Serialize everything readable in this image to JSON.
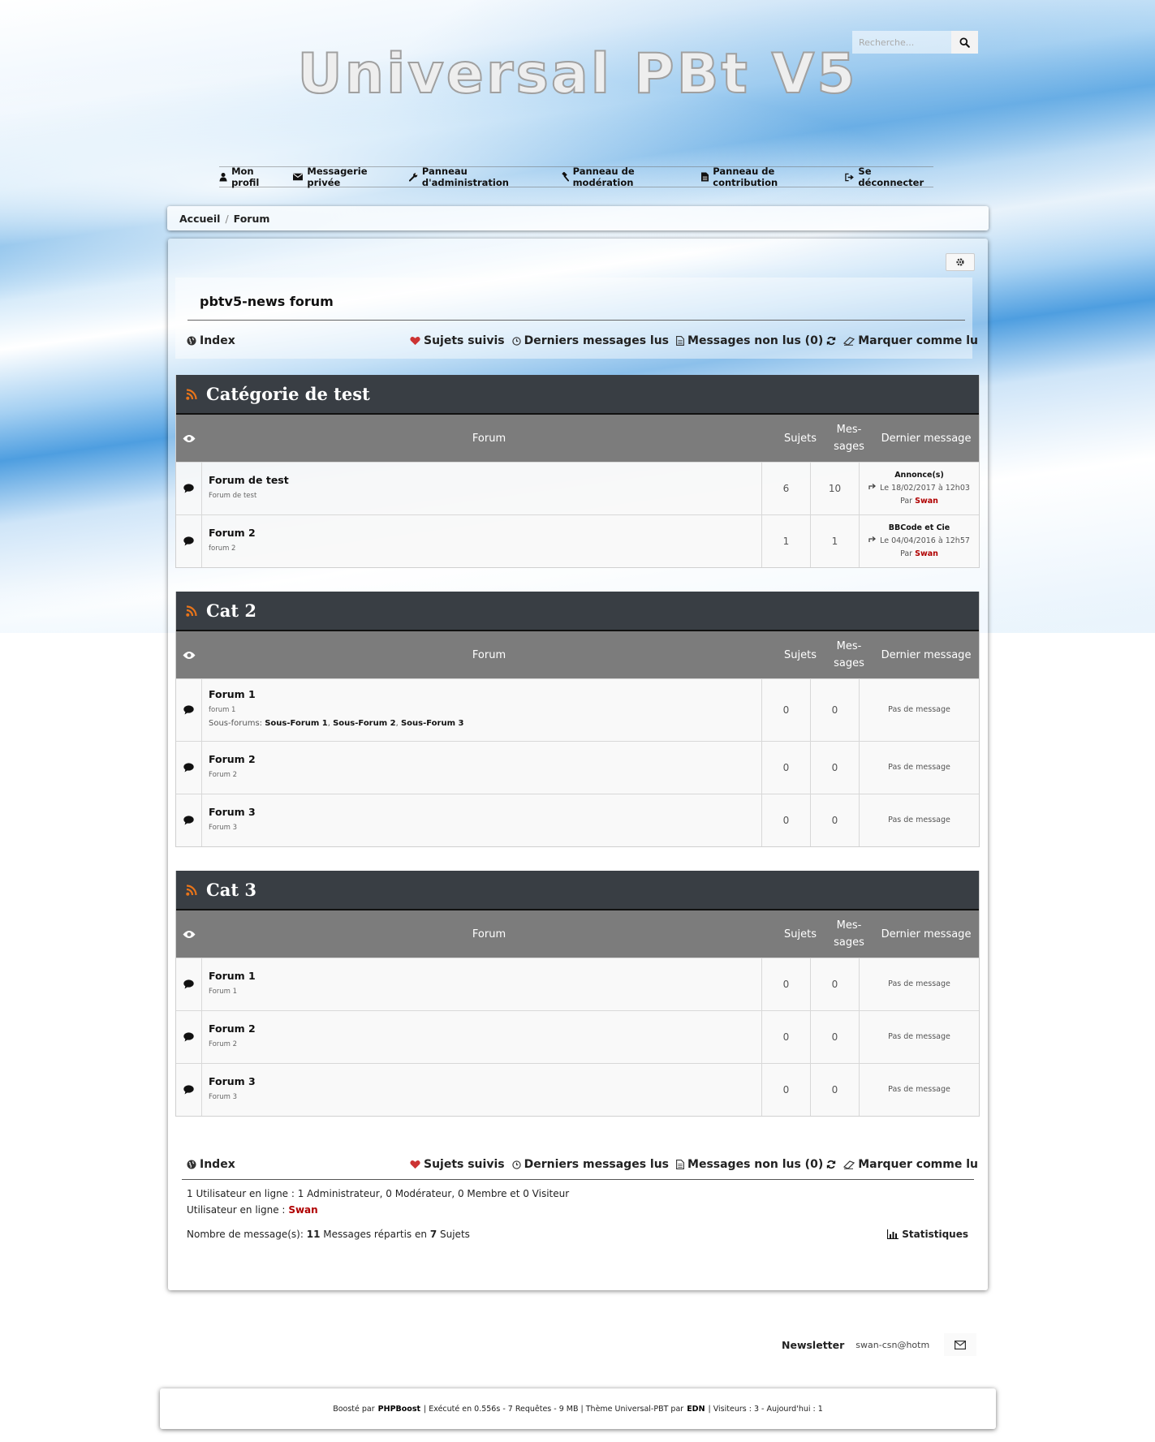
{
  "site": {
    "title": "Universal PBt V5"
  },
  "search": {
    "placeholder": "Recherche..."
  },
  "nav": [
    {
      "label": "Mon profil",
      "icon": "user-icon"
    },
    {
      "label": "Messagerie privée",
      "icon": "envelope-icon"
    },
    {
      "label": "Panneau d'administration",
      "icon": "wrench-icon"
    },
    {
      "label": "Panneau de modération",
      "icon": "gavel-icon"
    },
    {
      "label": "Panneau de contribution",
      "icon": "file-icon"
    },
    {
      "label": "Se déconnecter",
      "icon": "sign-out-icon"
    }
  ],
  "breadcrumb": [
    "Accueil",
    "Forum"
  ],
  "page": {
    "title": "pbtv5-news forum"
  },
  "links": {
    "index": "Index",
    "followed": "Sujets suivis",
    "last_read": "Derniers messages lus",
    "unread": "Messages non lus (0)",
    "mark_read": "Marquer comme lu"
  },
  "columns": {
    "forum": "Forum",
    "topics": "Sujets",
    "messages_1": "Mes-",
    "messages_2": "sages",
    "last": "Dernier message"
  },
  "categories": [
    {
      "name": "Catégorie de test",
      "forums": [
        {
          "name": "Forum de test",
          "desc": "Forum de test",
          "topics": "6",
          "messages": "10",
          "last_title": "Annonce(s)",
          "last_date": "Le 18/02/2017 à 12h03",
          "last_by": "Par",
          "last_user": "Swan"
        },
        {
          "name": "Forum 2",
          "desc": "forum 2",
          "topics": "1",
          "messages": "1",
          "last_title": "BBCode et Cie",
          "last_date": "Le 04/04/2016 à 12h57",
          "last_by": "Par",
          "last_user": "Swan"
        }
      ]
    },
    {
      "name": "Cat 2",
      "forums": [
        {
          "name": "Forum 1",
          "desc": "forum 1",
          "subforums_label": "Sous-forums",
          "subforums": [
            "Sous-Forum 1",
            "Sous-Forum 2",
            "Sous-Forum 3"
          ],
          "topics": "0",
          "messages": "0",
          "no_message": "Pas de message"
        },
        {
          "name": "Forum 2",
          "desc": "Forum 2",
          "topics": "0",
          "messages": "0",
          "no_message": "Pas de message"
        },
        {
          "name": "Forum 3",
          "desc": "Forum 3",
          "topics": "0",
          "messages": "0",
          "no_message": "Pas de message"
        }
      ]
    },
    {
      "name": "Cat 3",
      "forums": [
        {
          "name": "Forum 1",
          "desc": "Forum 1",
          "topics": "0",
          "messages": "0",
          "no_message": "Pas de message"
        },
        {
          "name": "Forum 2",
          "desc": "Forum 2",
          "topics": "0",
          "messages": "0",
          "no_message": "Pas de message"
        },
        {
          "name": "Forum 3",
          "desc": "Forum 3",
          "topics": "0",
          "messages": "0",
          "no_message": "Pas de message"
        }
      ]
    }
  ],
  "stats": {
    "online_summary": "1 Utilisateur en ligne : 1 Administrateur, 0 Modérateur, 0 Membre et 0 Visiteur",
    "online_label": "Utilisateur en ligne :",
    "online_user": "Swan",
    "messages_prefix": "Nombre de message(s):",
    "messages_count": "11",
    "messages_mid": "Messages répartis en",
    "topics_count": "7",
    "topics_suffix": "Sujets",
    "stats_link": "Statistiques"
  },
  "newsletter": {
    "label": "Newsletter",
    "value": "swan-csn@hotm"
  },
  "footer": {
    "boosted": "Boosté par",
    "phpboost": "PHPBoost",
    "exec": "| Exécuté en 0.556s - 7 Requêtes - 9 MB | Thème Universal-PBT par",
    "edn": "EDN",
    "visitors": "| Visiteurs : 3 - Aujourd'hui : 1"
  },
  "colors": {
    "category_header": "#393e44",
    "subheader": "#7c7c7c",
    "rss": "#e8741a",
    "username": "#b00000",
    "heart": "#d22"
  }
}
